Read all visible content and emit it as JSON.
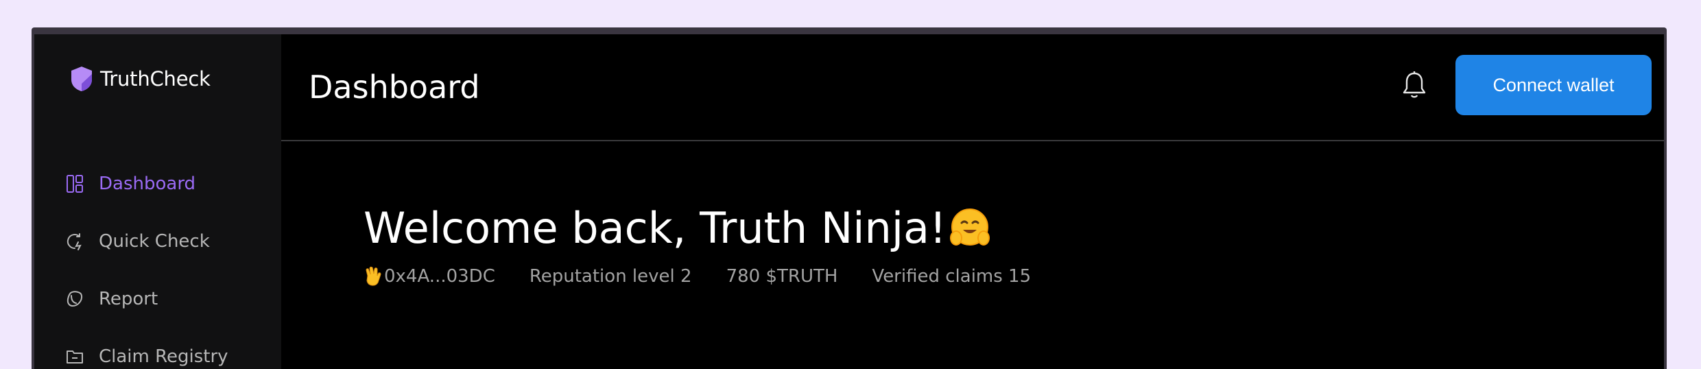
{
  "app": {
    "name": "TruthCheck",
    "logo_icon": "shield-icon",
    "accent_color": "#9b6bf5",
    "button_color": "#1f84e6"
  },
  "sidebar": {
    "items": [
      {
        "label": "Dashboard",
        "icon": "dashboard-icon",
        "active": true
      },
      {
        "label": "Quick Check",
        "icon": "quick-check-icon",
        "active": false
      },
      {
        "label": "Report",
        "icon": "report-icon",
        "active": false
      },
      {
        "label": "Claim Registry",
        "icon": "folder-icon",
        "active": false
      }
    ]
  },
  "header": {
    "title": "Dashboard",
    "notification_icon": "bell-icon",
    "connect_button": "Connect wallet"
  },
  "main": {
    "welcome_text": "Welcome back, Truth Ninja!",
    "welcome_emoji": "hugging-face-emoji",
    "stats": {
      "wallet_emoji": "waving-hand-emoji",
      "wallet": "0x4A...03DC",
      "reputation": "Reputation level 2",
      "balance": "780 $TRUTH",
      "verified": "Verified claims 15"
    }
  }
}
